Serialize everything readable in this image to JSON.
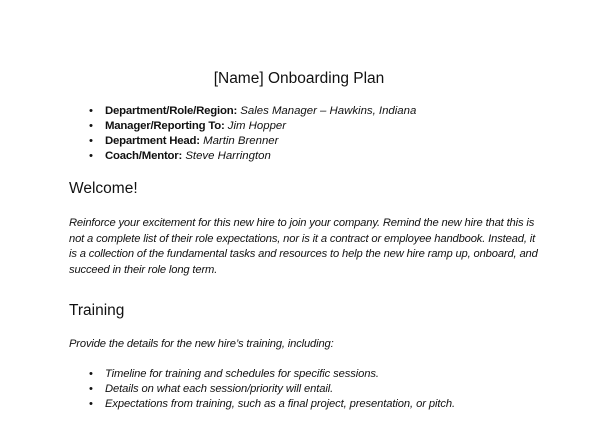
{
  "document": {
    "title": "[Name] Onboarding Plan",
    "info": [
      {
        "label": "Department/Role/Region:",
        "value": "Sales Manager – Hawkins, Indiana"
      },
      {
        "label": "Manager/Reporting To:",
        "value": "Jim Hopper"
      },
      {
        "label": "Department Head:",
        "value": "Martin Brenner"
      },
      {
        "label": "Coach/Mentor:",
        "value": "Steve Harrington"
      }
    ],
    "welcome": {
      "heading": "Welcome!",
      "paragraph": "Reinforce your excitement for this new hire to join your company. Remind the new hire that this is not a complete list of their role expectations, nor is it a contract or employee handbook. Instead, it is a collection of the fundamental tasks and resources to help the new hire ramp up, onboard, and succeed in their role long term."
    },
    "training": {
      "heading": "Training",
      "intro": "Provide the details for the new hire’s training, including:",
      "items": [
        "Timeline for training and schedules for specific sessions.",
        "Details on what each session/priority will entail.",
        "Expectations from training, such as a final project, presentation, or pitch."
      ]
    }
  }
}
